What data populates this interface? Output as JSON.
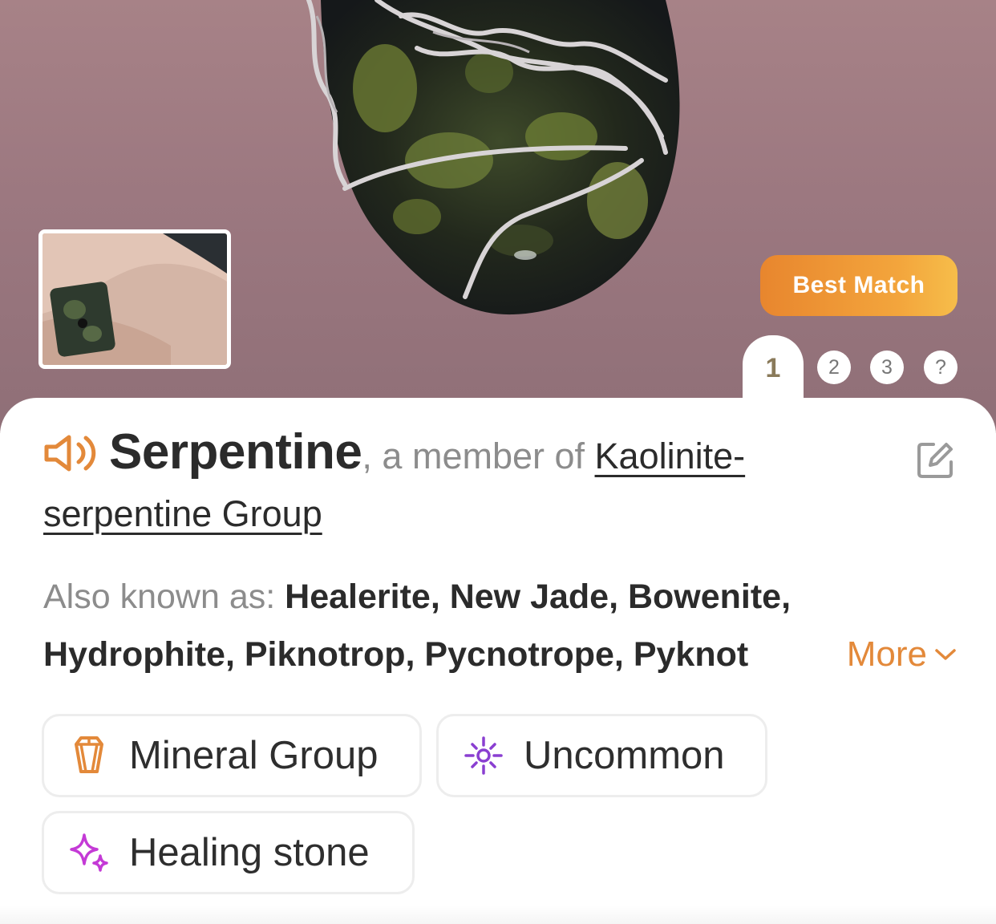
{
  "hero": {
    "best_match_label": "Best Match",
    "ranks": [
      "1",
      "2",
      "3",
      "?"
    ],
    "active_rank": "1"
  },
  "result": {
    "name": "Serpentine",
    "member_text": ", a member of ",
    "group_link": "Kaolinite-serpentine Group",
    "also_known_label": "Also known as: ",
    "also_known_line1": "Healerite, New Jade, Bowenite,",
    "also_known_line2": "Hydrophite, Piknotrop, Pycnotrope, Pyknot",
    "more_label": "More"
  },
  "tags": [
    {
      "label": "Mineral Group",
      "icon": "crystal-icon"
    },
    {
      "label": "Uncommon",
      "icon": "sparkle-burst-icon"
    },
    {
      "label": "Healing stone",
      "icon": "sparkles-icon"
    }
  ],
  "colors": {
    "accent_orange": "#e3893a",
    "uncommon_purple": "#8a3fd1",
    "healing_magenta": "#c43ad6"
  }
}
